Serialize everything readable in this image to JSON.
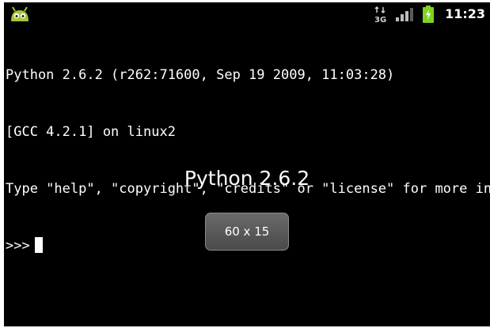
{
  "status_bar": {
    "time": "11:23",
    "icons": [
      "android-icon",
      "network-3g-icon",
      "signal-icon",
      "battery-charging-icon"
    ],
    "colors": {
      "battery": "#7ed321",
      "android": "#a4c639"
    }
  },
  "terminal": {
    "lines": [
      "Python 2.6.2 (r262:71600, Sep 19 2009, 11:03:28)",
      "[GCC 4.2.1] on linux2",
      "Type \"help\", \"copyright\", \"credits\" or \"license\" for more in"
    ],
    "prompt": ">>>"
  },
  "overlay": {
    "title": "Python 2.6.2",
    "size_label": "60 x 15"
  }
}
